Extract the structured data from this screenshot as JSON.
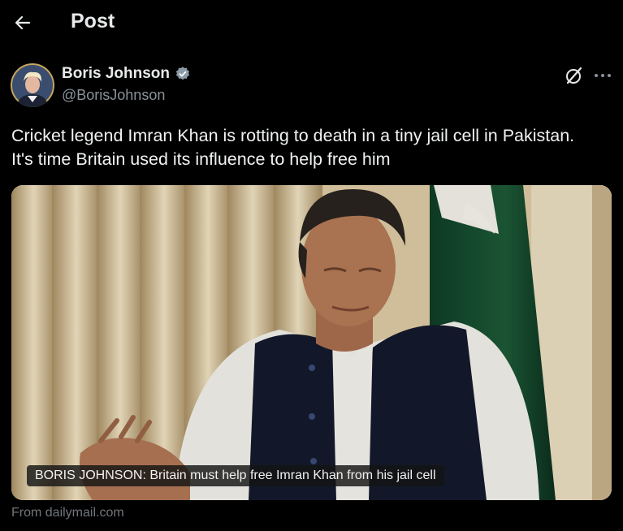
{
  "header": {
    "title": "Post",
    "back_icon": "arrow-left-icon"
  },
  "author": {
    "display_name": "Boris Johnson",
    "handle": "@BorisJohnson",
    "verified": true,
    "verified_color": "#1d9bf0"
  },
  "tweet": {
    "line1": "Cricket legend Imran Khan is rotting to death in a tiny jail cell in Pakistan.",
    "line2": "It's time Britain used its influence to help free him"
  },
  "card": {
    "caption": "BORIS JOHNSON: Britain must help free Imran Khan from his jail cell",
    "source": "From dailymail.com"
  },
  "icons": {
    "grok": "grok-icon",
    "more": "more-icon"
  }
}
